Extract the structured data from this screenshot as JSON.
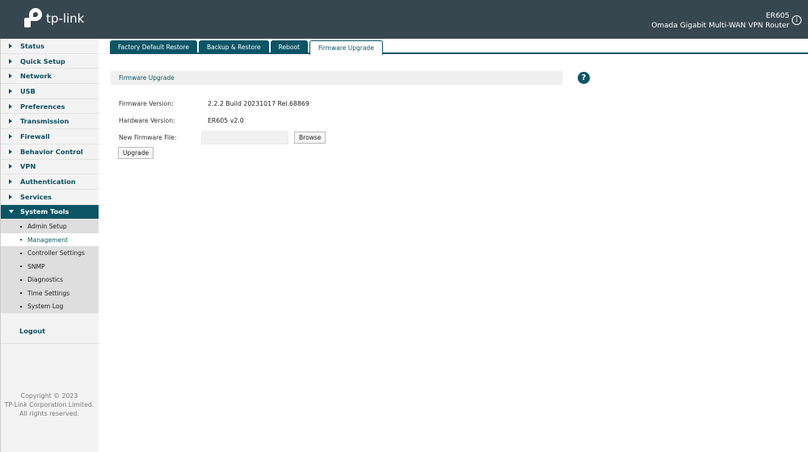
{
  "header": {
    "logo_text": "tp-link",
    "model": "ER605",
    "description": "Omada Gigabit Multi-WAN VPN Router"
  },
  "sidebar": {
    "items": [
      {
        "label": "Status"
      },
      {
        "label": "Quick Setup"
      },
      {
        "label": "Network"
      },
      {
        "label": "USB"
      },
      {
        "label": "Preferences"
      },
      {
        "label": "Transmission"
      },
      {
        "label": "Firewall"
      },
      {
        "label": "Behavior Control"
      },
      {
        "label": "VPN"
      },
      {
        "label": "Authentication"
      },
      {
        "label": "Services"
      },
      {
        "label": "System Tools"
      }
    ],
    "subitems": [
      {
        "label": "Admin Setup"
      },
      {
        "label": "Management"
      },
      {
        "label": "Controller Settings"
      },
      {
        "label": "SNMP"
      },
      {
        "label": "Diagnostics"
      },
      {
        "label": "Time Settings"
      },
      {
        "label": "System Log"
      }
    ],
    "logout": "Logout",
    "copyright": [
      "Copyright © 2023",
      "TP-Link Corporation Limited.",
      "All rights reserved."
    ]
  },
  "tabs": [
    {
      "label": "Factory Default Restore"
    },
    {
      "label": "Backup & Restore"
    },
    {
      "label": "Reboot"
    },
    {
      "label": "Firmware Upgrade"
    }
  ],
  "main": {
    "section_title": "Firmware Upgrade",
    "help": "?",
    "firmware_label": "Firmware Version:",
    "firmware_value": "2.2.2 Build 20231017 Rel.68869",
    "hardware_label": "Hardware Version:",
    "hardware_value": "ER605 v2.0",
    "file_label": "New Firmware File:",
    "file_value": "",
    "browse": "Browse",
    "upgrade": "Upgrade"
  }
}
